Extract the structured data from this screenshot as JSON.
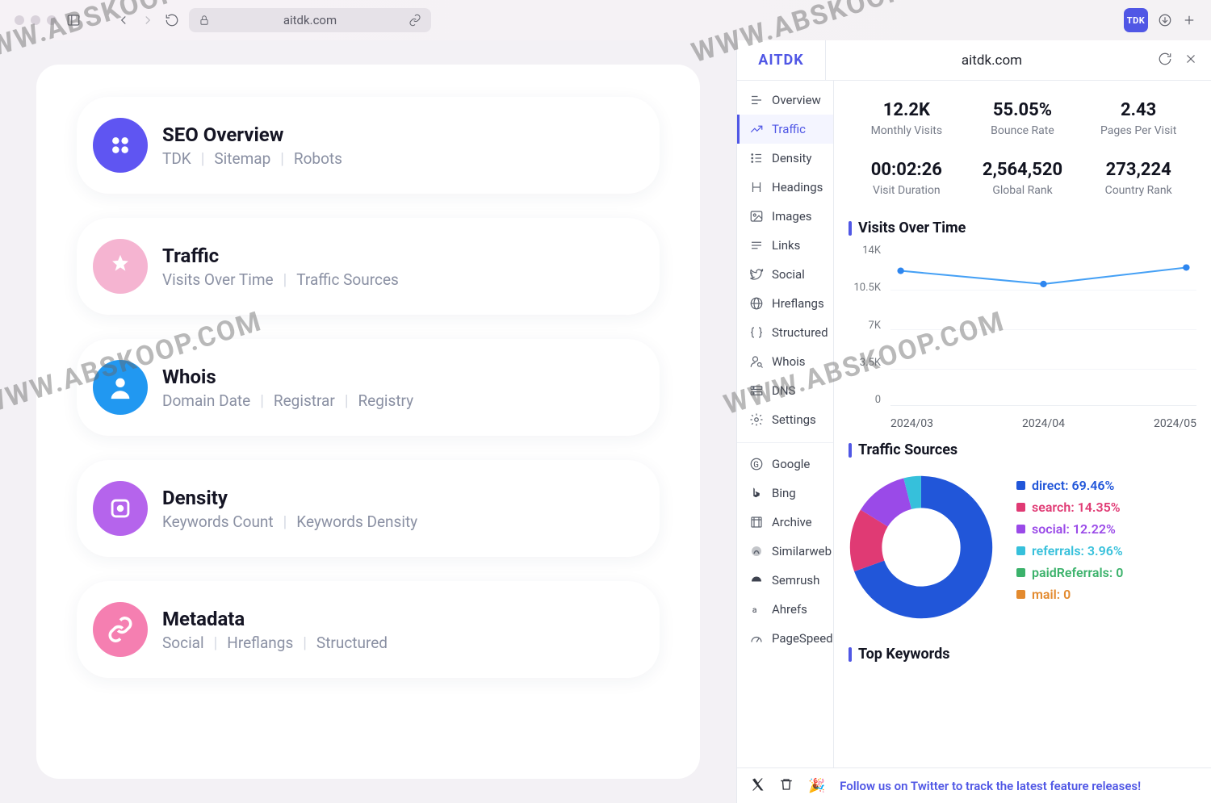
{
  "browser": {
    "url": "aitdk.com",
    "badge": "TDK"
  },
  "tiles": [
    {
      "title": "SEO Overview",
      "subs": [
        "TDK",
        "Sitemap",
        "Robots"
      ]
    },
    {
      "title": "Traffic",
      "subs": [
        "Visits Over Time",
        "Traffic Sources"
      ]
    },
    {
      "title": "Whois",
      "subs": [
        "Domain Date",
        "Registrar",
        "Registry"
      ]
    },
    {
      "title": "Density",
      "subs": [
        "Keywords Count",
        "Keywords Density"
      ]
    },
    {
      "title": "Metadata",
      "subs": [
        "Social",
        "Hreflangs",
        "Structured"
      ]
    }
  ],
  "ext": {
    "brand": "AITDK",
    "domain": "aitdk.com",
    "side1": [
      "Overview",
      "Traffic",
      "Density",
      "Headings",
      "Images",
      "Links",
      "Social",
      "Hreflangs",
      "Structured",
      "Whois",
      "DNS",
      "Settings"
    ],
    "side2": [
      "Google",
      "Bing",
      "Archive",
      "Similarweb",
      "Semrush",
      "Ahrefs",
      "PageSpeed"
    ],
    "active": "Traffic",
    "metrics": [
      {
        "v": "12.2K",
        "l": "Monthly Visits"
      },
      {
        "v": "55.05%",
        "l": "Bounce Rate"
      },
      {
        "v": "2.43",
        "l": "Pages Per Visit"
      },
      {
        "v": "00:02:26",
        "l": "Visit Duration"
      },
      {
        "v": "2,564,520",
        "l": "Global Rank"
      },
      {
        "v": "273,224",
        "l": "Country Rank"
      }
    ],
    "sections": {
      "visits": "Visits Over Time",
      "sources": "Traffic Sources",
      "keywords": "Top Keywords"
    },
    "sources": [
      {
        "label": "direct",
        "pct": 69.46,
        "color": "#2156d9"
      },
      {
        "label": "search",
        "pct": 14.35,
        "color": "#e03a74"
      },
      {
        "label": "social",
        "pct": 12.22,
        "color": "#9a4ae8"
      },
      {
        "label": "referrals",
        "pct": 3.96,
        "color": "#36c0db"
      },
      {
        "label": "paidReferrals",
        "pct": 0,
        "color": "#3bb26b"
      },
      {
        "label": "mail",
        "pct": 0,
        "color": "#e38a2e"
      }
    ],
    "footer": "Follow us on Twitter to track the latest feature releases!"
  },
  "chart_data": {
    "type": "line",
    "title": "Visits Over Time",
    "x": [
      "2024/03",
      "2024/04",
      "2024/05"
    ],
    "values": [
      12200,
      11000,
      12500
    ],
    "yticks": [
      "14K",
      "10.5K",
      "7K",
      "3.5K",
      "0"
    ],
    "ylim": [
      0,
      14000
    ]
  }
}
